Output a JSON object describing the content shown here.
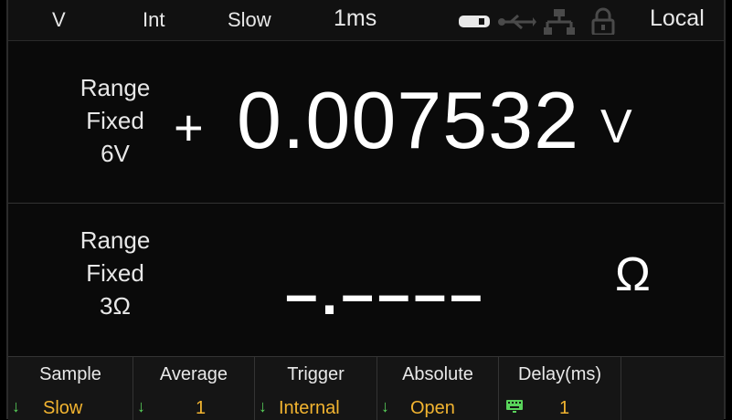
{
  "status_bar": {
    "mode": "V",
    "trigger": "Int",
    "speed": "Slow",
    "aperture": "1ms",
    "remote": "Local",
    "icons": [
      "usb-disk-icon",
      "usb-icon",
      "lan-icon",
      "lock-icon"
    ]
  },
  "primary": {
    "range_lines": [
      "Range",
      "Fixed",
      "6V"
    ],
    "sign": "+",
    "value": "0.007532",
    "unit": "V"
  },
  "secondary": {
    "range_lines": [
      "Range",
      "Fixed",
      "3Ω"
    ],
    "value": "–.––––",
    "unit": "Ω"
  },
  "softkeys": [
    {
      "label": "Sample",
      "value": "Slow",
      "icon": "down-arrow-icon"
    },
    {
      "label": "Average",
      "value": "1",
      "icon": "down-arrow-icon"
    },
    {
      "label": "Trigger",
      "value": "Internal",
      "icon": "down-arrow-icon"
    },
    {
      "label": "Absolute",
      "value": "Open",
      "icon": "down-arrow-icon"
    },
    {
      "label": "Delay(ms)",
      "value": "1",
      "icon": "keyboard-icon"
    },
    {
      "label": "",
      "value": "",
      "icon": ""
    }
  ],
  "colors": {
    "value_text": "#f2b430",
    "arrow": "#58d35a",
    "background": "#0a0a0a"
  }
}
